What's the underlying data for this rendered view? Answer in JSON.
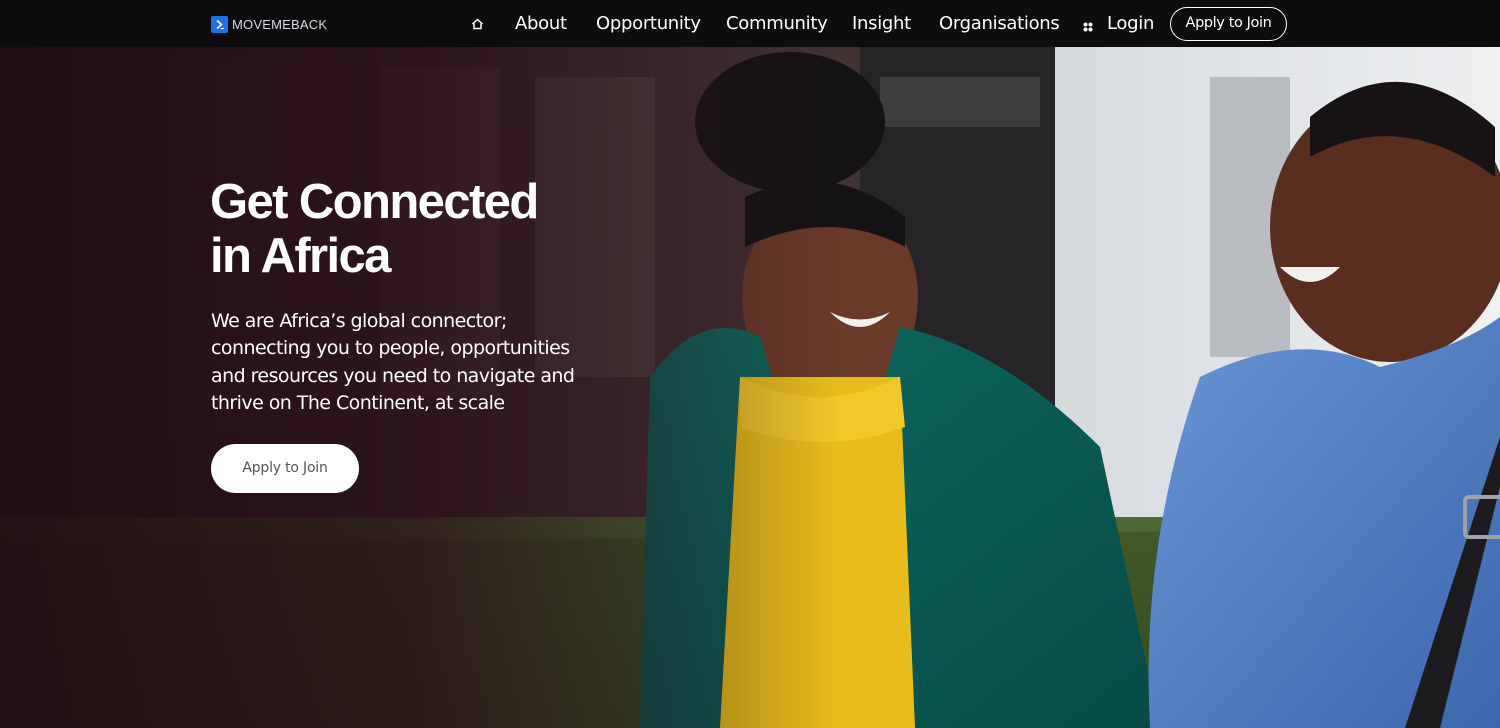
{
  "brand": {
    "name": "MOVEMEBACK",
    "logo_icon": "chevron-right-icon",
    "accent": "#1f6fe5"
  },
  "nav": {
    "home_icon": "home-icon",
    "items": [
      {
        "label": "About"
      },
      {
        "label": "Opportunity"
      },
      {
        "label": "Community"
      },
      {
        "label": "Insight"
      },
      {
        "label": "Organisations"
      }
    ],
    "login_icon": "grid-icon",
    "login_label": "Login",
    "apply_label": "Apply to Join"
  },
  "hero": {
    "title_line1": "Get Connected",
    "title_line2": "in Africa",
    "subtitle": "We are Africa’s global connector; connecting you to people, opportunities and resources you need to navigate and thrive on The Continent, at scale",
    "cta_label": "Apply to Join",
    "image": "hero-photo"
  }
}
